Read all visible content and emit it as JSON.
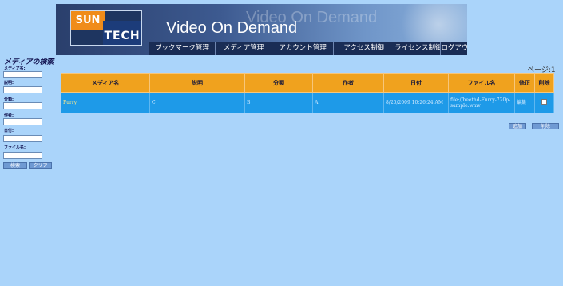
{
  "header": {
    "logo_sun": "SUN",
    "logo_tech": "TECH",
    "title": "Video On Demand",
    "watermark": "Video On Demand"
  },
  "nav": [
    "ブックマーク管理",
    "メディア管理",
    "アカウント管理",
    "アクセス制御",
    "ライセンス制御",
    "ログアウト"
  ],
  "sidebar": {
    "title": "メディアの検索",
    "fields": [
      "メディア名:",
      "説明:",
      "分類:",
      "作者:",
      "日付:",
      "ファイル名:"
    ],
    "search_button": "検索",
    "clear_button": "クリア"
  },
  "pager": "ページ:1",
  "table": {
    "headers": [
      "メディア名",
      "説明",
      "分類",
      "作者",
      "日付",
      "ファイル名",
      "修正",
      "削除"
    ],
    "rows": [
      {
        "name": "Furry",
        "description": "C",
        "category": "B",
        "author": "A",
        "date": "8/20/2009 10:26:24 AM",
        "filename": "file://beethd-Furry-720p-sample.wmv",
        "edit": "編集"
      }
    ]
  },
  "actions": {
    "add": "追加",
    "delete": "削除"
  }
}
